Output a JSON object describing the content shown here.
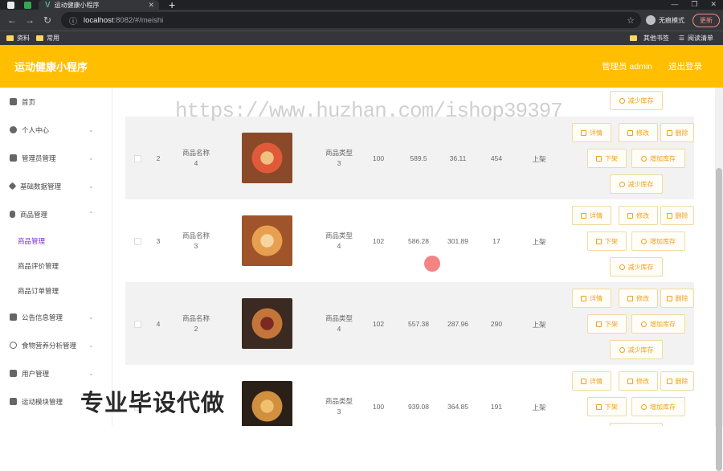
{
  "browser": {
    "tab_title": "运动健康小程序",
    "url_host": "localhost",
    "url_path": ":8082/#/meishi",
    "incognito_label": "无痕模式",
    "update_label": "更新",
    "bookmarks": [
      "资料",
      "常用"
    ],
    "bookmarks_right": [
      "其他书签",
      "阅读清单"
    ]
  },
  "header": {
    "title": "运动健康小程序",
    "user": "管理员 admin",
    "logout": "退出登录"
  },
  "sidebar": {
    "items": [
      {
        "label": "首页"
      },
      {
        "label": "个人中心"
      },
      {
        "label": "管理员管理"
      },
      {
        "label": "基础数据管理"
      },
      {
        "label": "商品管理"
      }
    ],
    "subitems": [
      {
        "label": "商品管理"
      },
      {
        "label": "商品评价管理"
      },
      {
        "label": "商品订单管理"
      }
    ],
    "items2": [
      {
        "label": "公告信息管理"
      },
      {
        "label": "食物营养分析管理"
      },
      {
        "label": "用户管理"
      },
      {
        "label": "运动模块管理"
      }
    ]
  },
  "table": {
    "rows": [
      {
        "index": "2",
        "name": "商品名称\n4",
        "type": "商品类型\n3",
        "c1": "100",
        "c2": "589.5",
        "c3": "36.11",
        "c4": "454",
        "status": "上架"
      },
      {
        "index": "3",
        "name": "商品名称\n3",
        "type": "商品类型\n4",
        "c1": "102",
        "c2": "586.28",
        "c3": "301.89",
        "c4": "17",
        "status": "上架"
      },
      {
        "index": "4",
        "name": "商品名称\n2",
        "type": "商品类型\n4",
        "c1": "102",
        "c2": "557.38",
        "c3": "287.96",
        "c4": "290",
        "status": "上架"
      },
      {
        "index": "",
        "name": "",
        "type": "商品类型\n3",
        "c1": "100",
        "c2": "939.08",
        "c3": "364.85",
        "c4": "191",
        "status": "上架"
      }
    ],
    "buttons": {
      "detail": "详情",
      "edit": "修改",
      "delete": "删除",
      "off_shelf": "下架",
      "add_stock": "增加库存",
      "reduce_stock": "减少库存"
    },
    "top_partial_button": "减少库存"
  },
  "overlay": {
    "watermark": "https://www.huzhan.com/ishop39397",
    "caption": "专业毕设代做"
  }
}
